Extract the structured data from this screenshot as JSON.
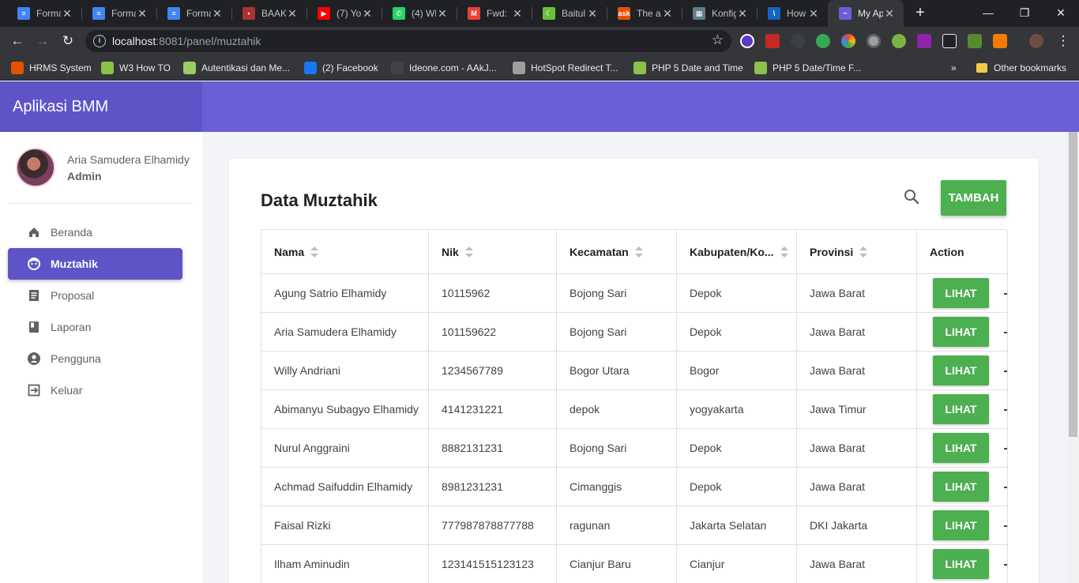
{
  "browser": {
    "tabs": [
      {
        "title": "Forma",
        "fav": "#4285f4",
        "glyph": "≡"
      },
      {
        "title": "Forma",
        "fav": "#4285f4",
        "glyph": "≡"
      },
      {
        "title": "Forma",
        "fav": "#4285f4",
        "glyph": "≡"
      },
      {
        "title": "BAAK",
        "fav": "#a33",
        "glyph": "•"
      },
      {
        "title": "(7) Yo",
        "fav": "#ff0000",
        "glyph": "▶"
      },
      {
        "title": "(4) Wh",
        "fav": "#25d366",
        "glyph": "✆"
      },
      {
        "title": "Fwd:",
        "fav": "#ea4335",
        "glyph": "M"
      },
      {
        "title": "Baitul",
        "fav": "#6bbf3b",
        "glyph": "☾"
      },
      {
        "title": "The a",
        "fav": "#e65100",
        "glyph": "ask"
      },
      {
        "title": "Konfig",
        "fav": "#607d8b",
        "glyph": "▦"
      },
      {
        "title": "How I",
        "fav": "#1565c0",
        "glyph": "\\"
      },
      {
        "title": "My Ap",
        "fav": "#6a5fd6",
        "glyph": "~"
      }
    ],
    "url_host": "localhost",
    "url_rest": ":8081/panel/muztahik",
    "bookmarks": [
      {
        "label": "HRMS System",
        "fav": "#e65100"
      },
      {
        "label": "W3 How TO",
        "fav": "#8bc34a"
      },
      {
        "label": "Autentikasi dan Me...",
        "fav": "#9ccc65"
      },
      {
        "label": "(2) Facebook",
        "fav": "#1877f2"
      },
      {
        "label": "Ideone.com - AAkJ...",
        "fav": "#424242"
      },
      {
        "label": "HotSpot Redirect T...",
        "fav": "#9e9e9e"
      },
      {
        "label": "PHP 5 Date and Time",
        "fav": "#8bc34a"
      },
      {
        "label": "PHP 5 Date/Time F...",
        "fav": "#8bc34a"
      }
    ],
    "more_bookmarks": "»",
    "other_bookmarks": "Other bookmarks"
  },
  "app": {
    "brand": "Aplikasi BMM",
    "user": {
      "name": "Aria Samudera Elhamidy",
      "role": "Admin"
    },
    "nav": [
      {
        "label": "Beranda",
        "icon": "home-icon",
        "active": false
      },
      {
        "label": "Muztahik",
        "icon": "face-icon",
        "active": true
      },
      {
        "label": "Proposal",
        "icon": "document-icon",
        "active": false
      },
      {
        "label": "Laporan",
        "icon": "book-icon",
        "active": false
      },
      {
        "label": "Pengguna",
        "icon": "account-icon",
        "active": false
      },
      {
        "label": "Keluar",
        "icon": "logout-icon",
        "active": false
      }
    ],
    "page_title": "Data Muztahik",
    "add_button": "TAMBAH",
    "view_button": "LIHAT",
    "columns": [
      "Nama",
      "Nik",
      "Kecamatan",
      "Kabupaten/Ko...",
      "Provinsi",
      "Action"
    ],
    "rows": [
      [
        "Agung Satrio Elhamidy",
        "10115962",
        "Bojong Sari",
        "Depok",
        "Jawa Barat"
      ],
      [
        "Aria Samudera Elhamidy",
        "101159622",
        "Bojong Sari",
        "Depok",
        "Jawa Barat"
      ],
      [
        "Willy Andriani",
        "1234567789",
        "Bogor Utara",
        "Bogor",
        "Jawa Barat"
      ],
      [
        "Abimanyu Subagyo Elhamidy",
        "4141231221",
        "depok",
        "yogyakarta",
        "Jawa Timur"
      ],
      [
        "Nurul Anggraini",
        "8882131231",
        "Bojong Sari",
        "Depok",
        "Jawa Barat"
      ],
      [
        "Achmad Saifuddin Elhamidy",
        "8981231231",
        "Cimanggis",
        "Depok",
        "Jawa Barat"
      ],
      [
        "Faisal Rizki",
        "777987878877788",
        "ragunan",
        "Jakarta Selatan",
        "DKI Jakarta"
      ],
      [
        "Ilham Aminudin",
        "123141515123123",
        "Cianjur Baru",
        "Cianjur",
        "Jawa Barat"
      ]
    ],
    "colors": {
      "brand": "#5e54c7",
      "appbar": "#6a5fd6",
      "success": "#4caf50"
    }
  }
}
